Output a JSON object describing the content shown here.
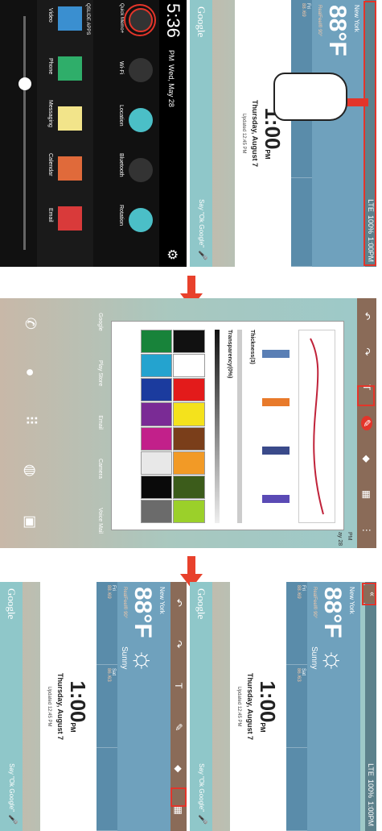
{
  "status": {
    "signal": "LTE",
    "battery": "100%",
    "time": "1:00PM"
  },
  "weather": {
    "city": "New York",
    "temp": "88°F",
    "feels": "RealFeel® 90°",
    "condition": "Sunny",
    "days": [
      {
        "label": "Fri",
        "temps": "88 /69"
      },
      {
        "label": "Sat",
        "temps": "86 /63"
      }
    ]
  },
  "clock": {
    "time": "1:00",
    "ampm": "PM",
    "date": "Thursday, August 7",
    "updated": "Updated 12:45 PM"
  },
  "google": {
    "logo": "Google",
    "hint": "Say \"Ok Google\""
  },
  "notification_panel": {
    "time": "5:36",
    "ampm": "PM",
    "date": "Wed, May 28",
    "toggles": [
      "Quick Memo+",
      "Wi-Fi",
      "Location",
      "Bluetooth",
      "Rotation"
    ],
    "brand": "QSLIDE APPS",
    "apps": [
      "Video",
      "Phone",
      "Messaging",
      "Calendar",
      "Email"
    ]
  },
  "memo_tools": {
    "thickness_label": "Thickness(3)",
    "transparency_label": "Transparency(0%)",
    "dock": [
      "Google",
      "Play Store",
      "Email",
      "Camera",
      "Voice Mail"
    ],
    "clock_fragment": "PM",
    "date_fragment": "ay 28"
  },
  "palette": [
    "#111111",
    "#ffffff",
    "#e31b1b",
    "#f4e21c",
    "#7a3e1a",
    "#f29a26",
    "#3c5c1b",
    "#9bd02a",
    "#18833a",
    "#24a3cf",
    "#1b3b9e",
    "#7a2b95",
    "#c2208a",
    "#e8e8e8",
    "#0a0a0a",
    "#6b6b6b"
  ],
  "colors": {
    "accent": "#e3352a",
    "arrow": "#e8412c"
  }
}
